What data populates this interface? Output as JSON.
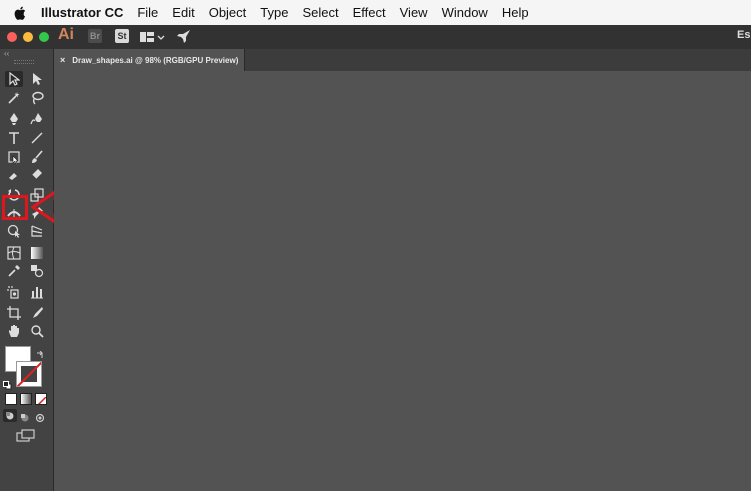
{
  "menubar": {
    "app_name": "Illustrator CC",
    "items": [
      "File",
      "Edit",
      "Object",
      "Type",
      "Select",
      "Effect",
      "View",
      "Window",
      "Help"
    ]
  },
  "app_bar": {
    "logo": "Ai",
    "bridge": "Br",
    "stock": "St",
    "workspace_truncated": "Es"
  },
  "document_tab": {
    "title": "Draw_shapes.ai @ 98% (RGB/GPU Preview)",
    "close": "×"
  },
  "toolbar": {
    "collapse": "‹‹",
    "tools": [
      "selection-tool-icon",
      "direct-selection-tool-icon",
      "magic-wand-tool-icon",
      "lasso-tool-icon",
      "pen-tool-icon",
      "curvature-tool-icon",
      "type-tool-icon",
      "line-segment-tool-icon",
      "rectangle-tool-icon",
      "paintbrush-tool-icon",
      "shaper-tool-icon",
      "eraser-tool-icon",
      "rotate-tool-icon",
      "scale-tool-icon",
      "width-tool-icon",
      "puppet-warp-tool-icon",
      "shape-builder-tool-icon",
      "perspective-grid-tool-icon",
      "mesh-tool-icon",
      "gradient-tool-icon",
      "eyedropper-tool-icon",
      "blend-tool-icon",
      "symbol-sprayer-tool-icon",
      "column-graph-tool-icon",
      "artboard-tool-icon",
      "slice-tool-icon",
      "hand-tool-icon",
      "zoom-tool-icon"
    ],
    "selected_tool": "rectangle-tool-icon"
  },
  "colors": {
    "menubar": "#f5f5f5",
    "titlebar": "#323232",
    "toolpanel": "#434343",
    "canvas": "#535353",
    "highlight": "#e0161d",
    "close": "#fc605c",
    "minimize": "#fdbc40",
    "zoom": "#34c84a",
    "ai_brand": "#d2865a"
  }
}
